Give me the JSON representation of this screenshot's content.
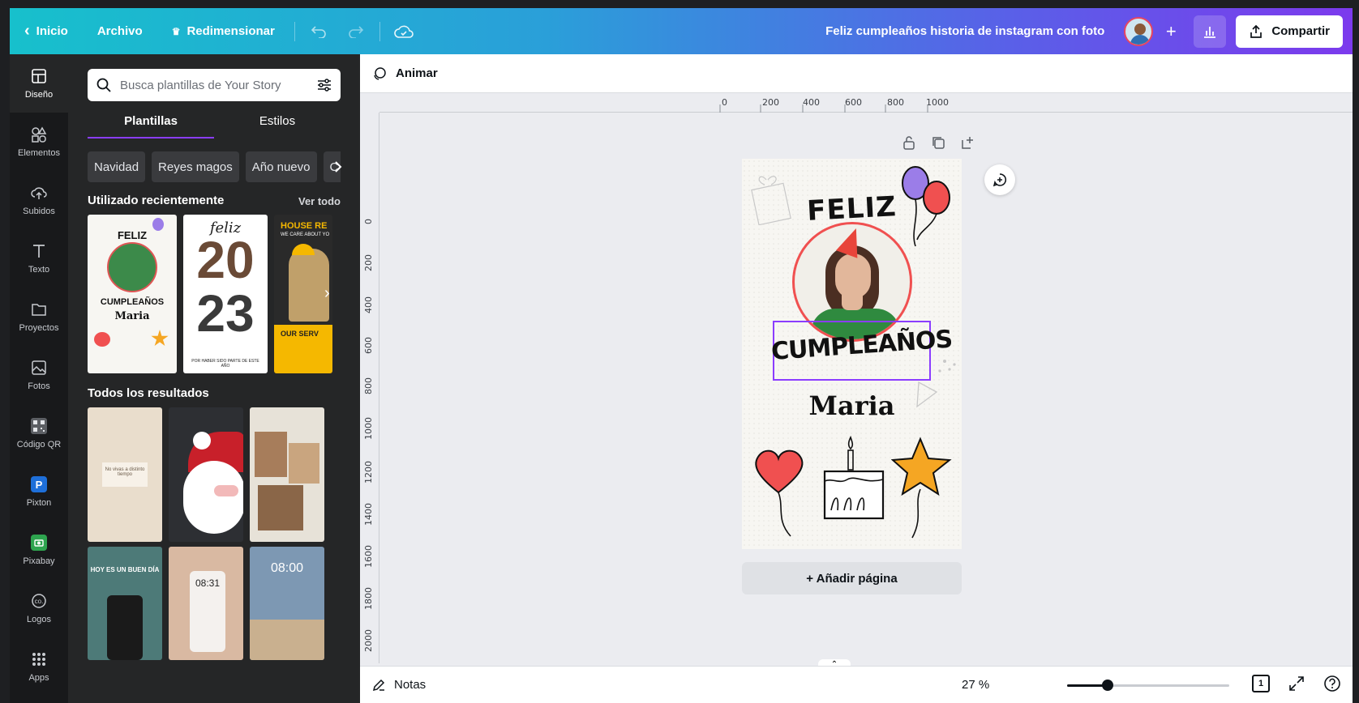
{
  "topbar": {
    "home_label": "Inicio",
    "file_label": "Archivo",
    "resize_label": "Redimensionar",
    "doc_title": "Feliz cumpleaños historia de instagram con foto",
    "share_label": "Compartir"
  },
  "sidebar": {
    "items": [
      {
        "label": "Diseño",
        "icon": "layout-icon"
      },
      {
        "label": "Elementos",
        "icon": "shapes-icon"
      },
      {
        "label": "Subidos",
        "icon": "upload-cloud-icon"
      },
      {
        "label": "Texto",
        "icon": "text-icon"
      },
      {
        "label": "Proyectos",
        "icon": "folder-icon"
      },
      {
        "label": "Fotos",
        "icon": "image-icon"
      },
      {
        "label": "Código QR",
        "icon": "qr-code-icon"
      },
      {
        "label": "Pixton",
        "icon": "pixton-icon"
      },
      {
        "label": "Pixabay",
        "icon": "pixabay-icon"
      },
      {
        "label": "Logos",
        "icon": "logos-icon"
      },
      {
        "label": "Apps",
        "icon": "apps-grid-icon"
      }
    ]
  },
  "panel": {
    "search_placeholder": "Busca plantillas de Your Story",
    "tabs": [
      "Plantillas",
      "Estilos"
    ],
    "chips": [
      "Navidad",
      "Reyes magos",
      "Año nuevo",
      "C"
    ],
    "recent_heading": "Utilizado recientemente",
    "see_all": "Ver todo",
    "all_results_heading": "Todos los resultados",
    "recent_thumbs": [
      {
        "line1": "FELIZ",
        "line2": "CUMPLEAÑOS",
        "line3": "Maria"
      },
      {
        "line1": "feliz",
        "line2": "20",
        "line3": "23",
        "footer": "POR HABER SIDO PARTE DE ESTE AÑO"
      },
      {
        "line1": "HOUSE RE",
        "line2": "WE CARE ABOUT YO",
        "line3": "OUR SERV"
      }
    ],
    "result_thumbs": [
      {
        "text": "No vivas a distinto tiempo"
      },
      {
        "text": ""
      },
      {
        "text": ""
      },
      {
        "text": "HOY ES UN BUEN DÍA"
      },
      {
        "text": "08:31"
      },
      {
        "text": "08:00"
      }
    ]
  },
  "canvas": {
    "animate_label": "Animar",
    "ruler_top": [
      "0",
      "200",
      "400",
      "600",
      "800",
      "1000"
    ],
    "ruler_left": [
      "0",
      "200",
      "400",
      "600",
      "800",
      "1000",
      "1200",
      "1400",
      "1600",
      "1800",
      "2000"
    ],
    "design": {
      "title": "FELIZ",
      "subtitle": "CUMPLEAÑOS",
      "name": "Maria"
    },
    "add_page_label": "+ Añadir página"
  },
  "bottombar": {
    "notes_label": "Notas",
    "zoom": "27 %",
    "zoom_fraction": 0.25,
    "page_count": "1"
  },
  "colors": {
    "accent": "#8b3dff",
    "balloon_purple": "#9b7de8",
    "balloon_red": "#f05050",
    "star": "#f5a623"
  }
}
